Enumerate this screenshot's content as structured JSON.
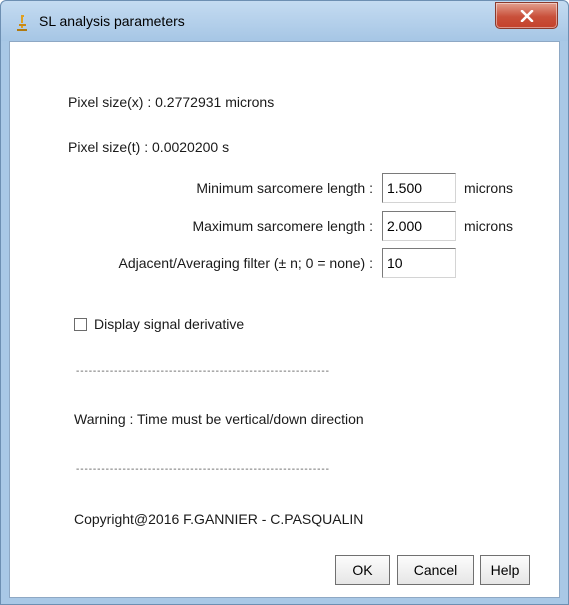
{
  "window": {
    "title": "SL analysis parameters"
  },
  "info": {
    "pixel_size_x": "Pixel size(x) : 0.2772931 microns",
    "pixel_size_t": "Pixel size(t) : 0.0020200 s"
  },
  "fields": {
    "min_length": {
      "label": "Minimum sarcomere length :",
      "value": "1.500",
      "unit": "microns"
    },
    "max_length": {
      "label": "Maximum sarcomere length :",
      "value": "2.000",
      "unit": "microns"
    },
    "filter": {
      "label": "Adjacent/Averaging filter (± n; 0 = none) :",
      "value": "10"
    }
  },
  "options": {
    "derivative_label": "Display signal derivative",
    "derivative_checked": false
  },
  "separator": "------------------------------------------------------------",
  "warning": "Warning : Time must be vertical/down direction",
  "copyright": "Copyright@2016 F.GANNIER - C.PASQUALIN",
  "buttons": {
    "ok": "OK",
    "cancel": "Cancel",
    "help": "Help"
  }
}
